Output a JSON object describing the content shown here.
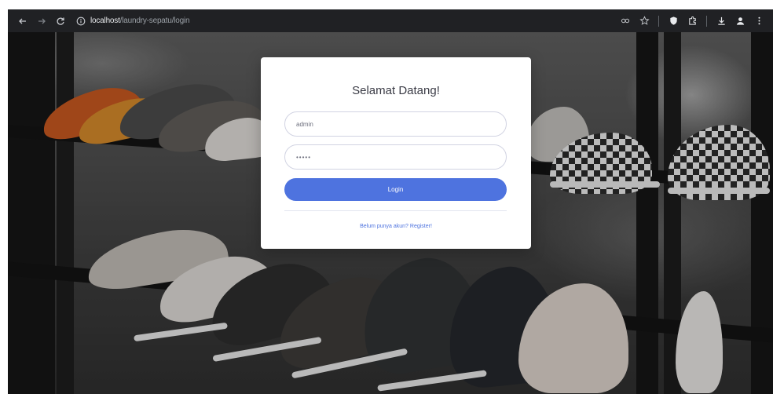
{
  "browser": {
    "url_host": "localhost",
    "url_path": "/laundry-sepatu/login"
  },
  "login": {
    "title": "Selamat Datang!",
    "username_value": "admin",
    "password_value": "•••••",
    "button_label": "Login",
    "register_link": "Belum punya akun? Register!"
  },
  "colors": {
    "accent": "#4e73df",
    "chrome_bg": "#202124"
  },
  "icons": {
    "back": "arrow-left-icon",
    "forward": "arrow-right-icon",
    "reload": "reload-icon",
    "site_info": "info-icon",
    "password_key": "key-icon",
    "bookmark": "star-icon",
    "shield": "shield-icon",
    "extensions": "puzzle-icon",
    "download": "download-icon",
    "profile": "profile-icon",
    "menu": "kebab-menu-icon"
  }
}
